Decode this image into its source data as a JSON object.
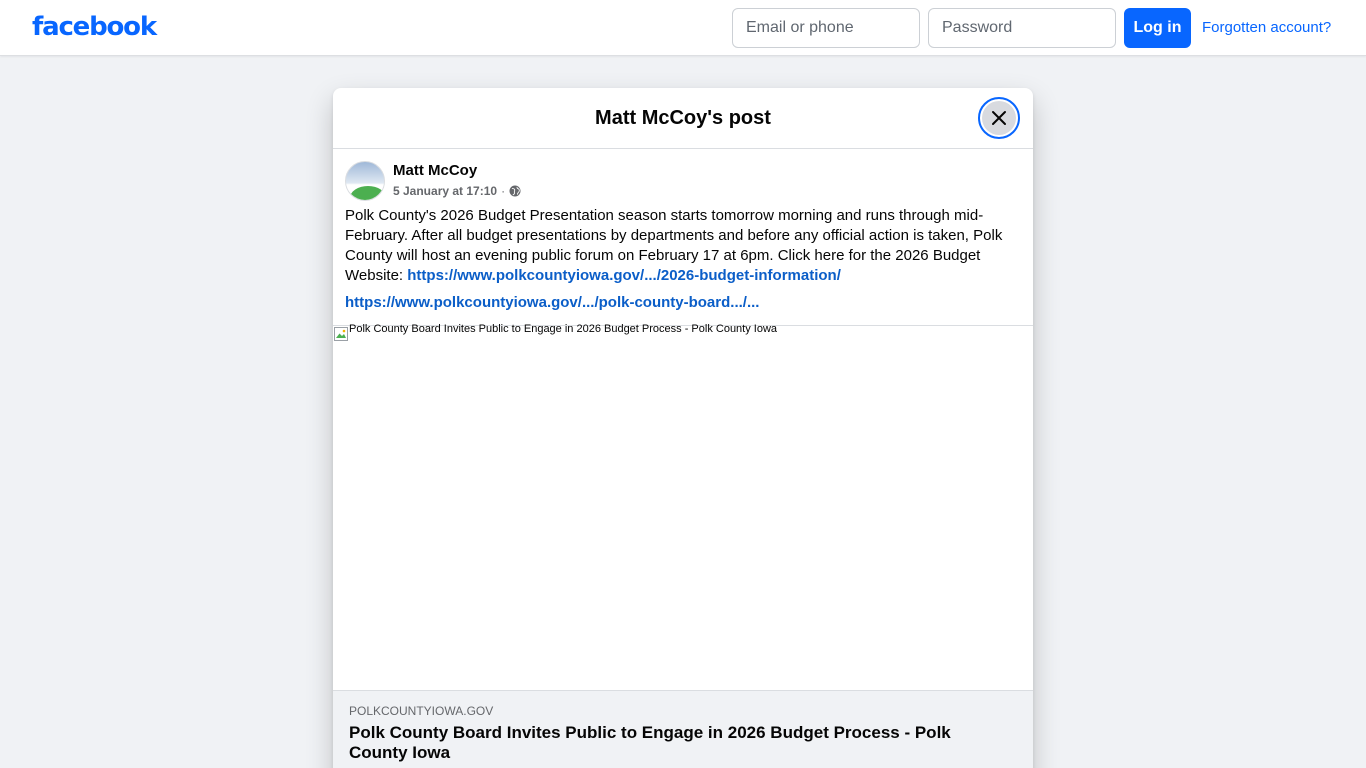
{
  "header": {
    "logo": "facebook",
    "email_placeholder": "Email or phone",
    "password_placeholder": "Password",
    "login_label": "Log in",
    "forgot_label": "Forgotten account?"
  },
  "modal": {
    "title": "Matt McCoy's post"
  },
  "post": {
    "author": "Matt McCoy",
    "timestamp": "5 January at 17:10",
    "separator": "·",
    "text": "Polk County's 2026 Budget Presentation season starts tomorrow morning and runs through mid-February. After all budget presentations by departments and before any official action is taken, Polk County will host an evening public forum on February 17 at 6pm. Click here for the 2026 Budget Website: ",
    "inline_link": "https://www.polkcountyiowa.gov/.../2026-budget-information/",
    "second_link": "https://www.polkcountyiowa.gov/.../polk-county-board.../..."
  },
  "preview": {
    "image_alt": "Polk County Board Invites Public to Engage in 2026 Budget Process - Polk County Iowa",
    "domain": "POLKCOUNTYIOWA.GOV",
    "title": "Polk County Board Invites Public to Engage in 2026 Budget Process - Polk County Iowa"
  },
  "colors": {
    "brand": "#0866ff",
    "link": "#0b5ec8",
    "page_bg": "#f0f2f5"
  },
  "icons": {
    "close": "close-icon",
    "audience": "globe-icon",
    "broken_image": "broken-image-icon"
  }
}
